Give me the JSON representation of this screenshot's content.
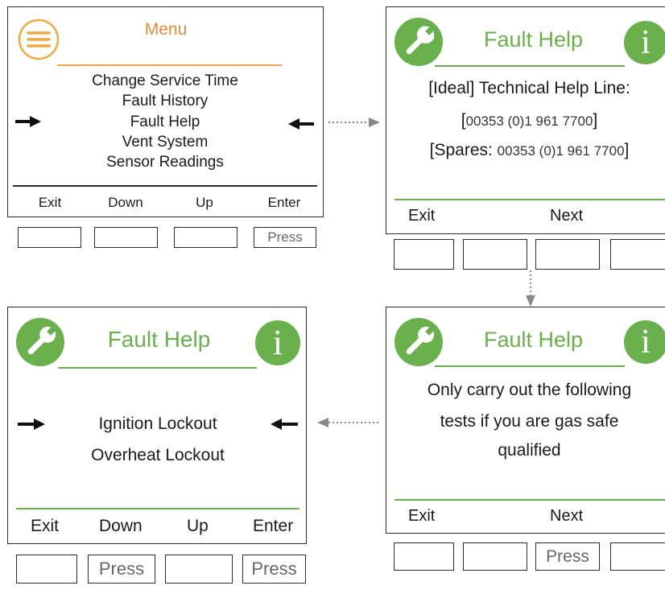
{
  "screen1": {
    "title": "Menu",
    "items": [
      "Change Service Time",
      "Fault History",
      "Fault Help",
      "Vent System",
      "Sensor Readings"
    ],
    "softkeys": [
      "Exit",
      "Down",
      "Up",
      "Enter"
    ],
    "buttons": [
      "",
      "",
      "",
      "Press"
    ]
  },
  "screen2": {
    "title": "Fault Help",
    "line1": "[Ideal] Technical Help Line:",
    "line2_open": "[",
    "line2_number": "00353 (0)1 961 7700",
    "line2_close": "]",
    "line3_prefix": "[Spares: ",
    "line3_number": "00353 (0)1 961 7700",
    "line3_close": "]",
    "softkeys": [
      "Exit",
      "Next"
    ],
    "buttons": [
      "",
      "",
      "",
      ""
    ]
  },
  "screen3": {
    "title": "Fault Help",
    "lines": [
      "Only carry out the following",
      "tests if you are gas safe",
      "qualified"
    ],
    "softkeys": [
      "Exit",
      "Next"
    ],
    "buttons": [
      "",
      "",
      "Press",
      ""
    ]
  },
  "screen4": {
    "title": "Fault Help",
    "items": [
      "Ignition Lockout",
      "Overheat Lockout"
    ],
    "softkeys": [
      "Exit",
      "Down",
      "Up",
      "Enter"
    ],
    "buttons": [
      "",
      "Press",
      "",
      "Press"
    ]
  },
  "colors": {
    "menu_orange": "#e8893a",
    "menu_icon_orange": "#f2a93b",
    "fault_green": "#6ab04c",
    "border": "#2b2b2b",
    "arrow_gray": "#888888"
  },
  "icons": [
    "hamburger-menu-icon",
    "wrench-icon",
    "info-icon",
    "right-arrow-icon",
    "left-arrow-icon"
  ]
}
